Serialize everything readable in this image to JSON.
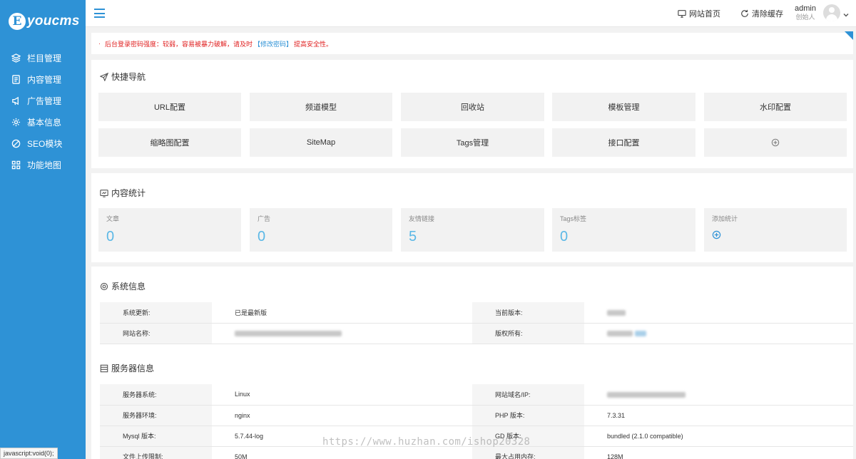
{
  "sidebar": {
    "logo_mark": "E",
    "logo_text": "youcms",
    "items": [
      {
        "label": "栏目管理",
        "icon": "layers-icon"
      },
      {
        "label": "内容管理",
        "icon": "document-icon"
      },
      {
        "label": "广告管理",
        "icon": "megaphone-icon"
      },
      {
        "label": "基本信息",
        "icon": "gear-icon"
      },
      {
        "label": "SEO模块",
        "icon": "globe-icon"
      },
      {
        "label": "功能地图",
        "icon": "grid-icon"
      }
    ]
  },
  "header": {
    "home_link": "网站首页",
    "clear_cache": "清除缓存",
    "user_name": "admin",
    "user_role": "创始人"
  },
  "notice": {
    "dot": "·",
    "text_before": "后台登录密码强度：较弱，容易被暴力破解，请及时",
    "link": "【修改密码】",
    "text_after": "提高安全性。"
  },
  "quick_nav": {
    "title": "快捷导航",
    "items": [
      "URL配置",
      "频道模型",
      "回收站",
      "模板管理",
      "水印配置",
      "缩略图配置",
      "SiteMap",
      "Tags管理",
      "接口配置"
    ]
  },
  "stats": {
    "title": "内容统计",
    "items": [
      {
        "label": "文章",
        "value": "0"
      },
      {
        "label": "广告",
        "value": "0"
      },
      {
        "label": "友情链接",
        "value": "5"
      },
      {
        "label": "Tags标签",
        "value": "0"
      }
    ],
    "add_label": "添加统计"
  },
  "system_info": {
    "title": "系统信息",
    "rows": [
      {
        "k1": "系统更新:",
        "v1": "已是最新版",
        "k2": "当前版本:"
      },
      {
        "k1": "网站名称:",
        "k2": "版权所有:"
      }
    ]
  },
  "server_info": {
    "title": "服务器信息",
    "rows": [
      {
        "k1": "服务器系统:",
        "v1": "Linux",
        "k2": "网站域名/IP:",
        "v2": ""
      },
      {
        "k1": "服务器环境:",
        "v1": "nginx",
        "k2": "PHP 版本:",
        "v2": "7.3.31"
      },
      {
        "k1": "Mysql 版本:",
        "v1": "5.7.44-log",
        "k2": "GD 版本:",
        "v2": "bundled (2.1.0 compatible)"
      },
      {
        "k1": "文件上传限制:",
        "v1": "50M",
        "k2": "最大占用内存:",
        "v2": "128M"
      }
    ]
  },
  "status_bar": "javascript:void(0);",
  "watermark": "https://www.huzhan.com/ishop20328",
  "colors": {
    "accent": "#2e92d6",
    "warning": "#e02020",
    "stat_value": "#5bb8e6"
  }
}
